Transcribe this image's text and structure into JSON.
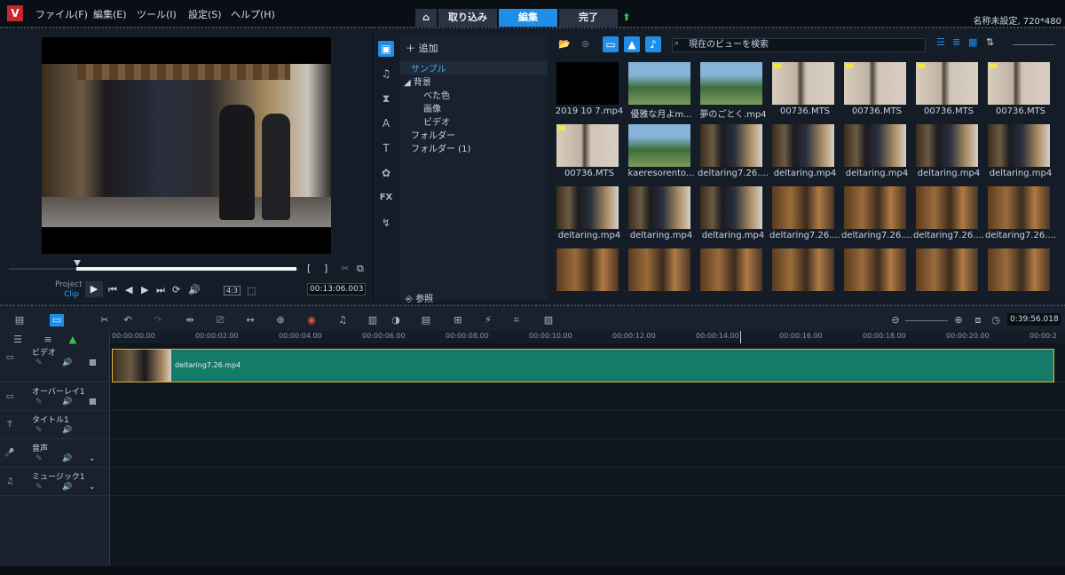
{
  "menu": {
    "logo": "V",
    "items": [
      "ファイル(F)",
      "編集(E)",
      "ツール(I)",
      "設定(S)",
      "ヘルプ(H)"
    ]
  },
  "modes": {
    "home_icon": "home-icon",
    "capture": "取り込み",
    "edit": "編集",
    "share": "完了",
    "upload_icon": "upload-arrow-icon"
  },
  "project_info": "名称未設定, 720*480",
  "player": {
    "project_label": "Project",
    "clip_label": "Clip",
    "play": "▶",
    "aspect": "4:3",
    "timecode": "00:13:06.003",
    "marker_in": "[",
    "marker_out": "]"
  },
  "library": {
    "add_label": "追加",
    "tree": {
      "sample": "サンプル",
      "background": "背景",
      "solid_color": "べた色",
      "image": "画像",
      "video": "ビデオ",
      "folder": "フォルダー",
      "folder1": "フォルダー (1)"
    },
    "browse_label": "参照",
    "search_placeholder": "現在のビューを検索",
    "thumbs": [
      {
        "caption": "2019 10 7.mp4",
        "kind": "black",
        "badge": false
      },
      {
        "caption": "優雅な月よm...",
        "kind": "landscape",
        "badge": false
      },
      {
        "caption": "夢のごとく.mp4",
        "kind": "landscape",
        "badge": false
      },
      {
        "caption": "00736.MTS",
        "kind": "room",
        "badge": true
      },
      {
        "caption": "00736.MTS",
        "kind": "room",
        "badge": true
      },
      {
        "caption": "00736.MTS",
        "kind": "room",
        "badge": true
      },
      {
        "caption": "00736.MTS",
        "kind": "room",
        "badge": true
      },
      {
        "caption": "00736.MTS",
        "kind": "room",
        "badge": true
      },
      {
        "caption": "kaeresorento...",
        "kind": "landscape",
        "badge": false
      },
      {
        "caption": "deltaring7.26....",
        "kind": "gym",
        "badge": false
      },
      {
        "caption": "deltaring.mp4",
        "kind": "gym",
        "badge": false
      },
      {
        "caption": "deltaring.mp4",
        "kind": "gym",
        "badge": false
      },
      {
        "caption": "deltaring.mp4",
        "kind": "gym",
        "badge": false
      },
      {
        "caption": "deltaring.mp4",
        "kind": "gym",
        "badge": false
      },
      {
        "caption": "deltaring.mp4",
        "kind": "gym",
        "badge": false
      },
      {
        "caption": "deltaring.mp4",
        "kind": "gym",
        "badge": false
      },
      {
        "caption": "deltaring.mp4",
        "kind": "gym",
        "badge": false
      },
      {
        "caption": "deltaring7.26....",
        "kind": "gym2",
        "badge": false
      },
      {
        "caption": "deltaring7.26....",
        "kind": "gym2",
        "badge": false
      },
      {
        "caption": "deltaring7.26....",
        "kind": "gym2",
        "badge": false
      },
      {
        "caption": "deltaring7.26....",
        "kind": "gym2",
        "badge": false
      },
      {
        "caption": "",
        "kind": "gym2",
        "badge": false
      },
      {
        "caption": "",
        "kind": "gym2",
        "badge": false
      },
      {
        "caption": "",
        "kind": "gym2",
        "badge": false
      },
      {
        "caption": "",
        "kind": "gym2",
        "badge": false
      },
      {
        "caption": "",
        "kind": "gym2",
        "badge": false
      },
      {
        "caption": "",
        "kind": "gym2",
        "badge": false
      },
      {
        "caption": "",
        "kind": "gym2",
        "badge": false
      }
    ]
  },
  "timeline": {
    "total_time": "0:39:56.018",
    "ticks": [
      "00:00:00.00",
      "00:00:02.00",
      "00:00:04.00",
      "00:00:06.00",
      "00:00:08.00",
      "00:00:10.00",
      "00:00:12.00",
      "00:00:14.00",
      "00:00:16.00",
      "00:00:18.00",
      "00:00:20.00",
      "00:00:2"
    ],
    "tracks": [
      {
        "name": "ビデオ",
        "icon": "video-track-icon"
      },
      {
        "name": "オーバーレイ1",
        "icon": "overlay-track-icon"
      },
      {
        "name": "タイトル1",
        "icon": "title-track-icon"
      },
      {
        "name": "音声",
        "icon": "voice-track-icon"
      },
      {
        "name": "ミュージック1",
        "icon": "music-track-icon"
      }
    ],
    "clip_label": "deltaring7.26.mp4"
  },
  "colors": {
    "accent": "#1f8ee8",
    "clip": "#157a68",
    "clip_border": "#e3b437"
  }
}
